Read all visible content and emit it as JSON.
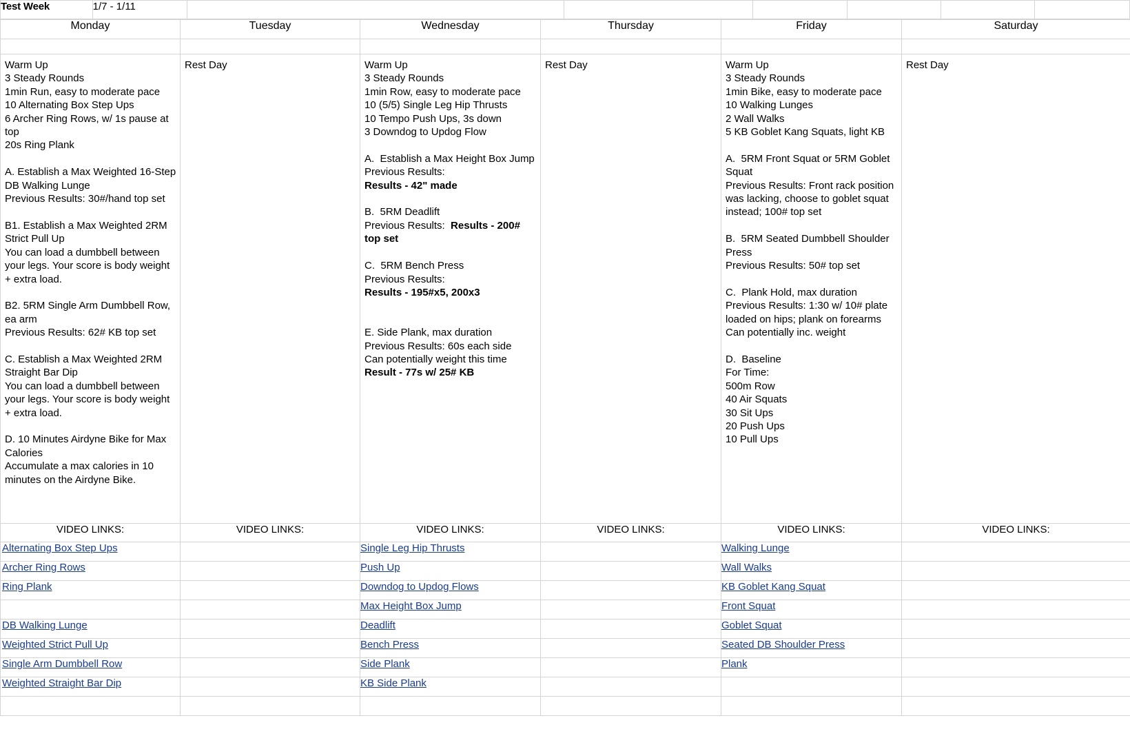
{
  "meta": {
    "title": "Test Week",
    "dates": "1/7 - 1/11"
  },
  "colors": {
    "header_band": "#fbe2cd",
    "sub_band": "#fae0ca",
    "link": "#1a3c8c",
    "grid_line": "#d4d4d4"
  },
  "days": [
    {
      "name": "Monday"
    },
    {
      "name": "Tuesday"
    },
    {
      "name": "Wednesday"
    },
    {
      "name": "Thursday"
    },
    {
      "name": "Friday"
    },
    {
      "name": "Saturday"
    }
  ],
  "workouts": {
    "monday": "Warm Up\n3 Steady Rounds\n1min Run, easy to moderate pace\n10 Alternating Box Step Ups\n6 Archer Ring Rows, w/ 1s pause at top\n20s Ring Plank\n\nA. Establish a Max Weighted 16-Step DB Walking Lunge\nPrevious Results: 30#/hand top set\n\nB1. Establish a Max Weighted 2RM Strict Pull Up\nYou can load a dumbbell between your legs. Your score is body weight + extra load.\n\nB2. 5RM Single Arm Dumbbell Row, ea arm\nPrevious Results: 62# KB top set\n\nC. Establish a Max Weighted 2RM Straight Bar Dip\nYou can load a dumbbell between your legs. Your score is body weight + extra load.\n\nD. 10 Minutes Airdyne Bike for Max Calories\nAccumulate a max calories in 10 minutes on the Airdyne Bike.",
    "tuesday": "Rest Day",
    "wednesday_part1": "Warm Up\n3 Steady Rounds\n1min Row, easy to moderate pace\n10 (5/5) Single Leg Hip Thrusts\n10 Tempo Push Ups, 3s down\n3 Downdog to Updog Flow\n\nA.  Establish a Max Height Box Jump\nPrevious Results:\n",
    "wednesday_bold1": "Results - 42\" made",
    "wednesday_part2": "\n\nB.  5RM Deadlift\nPrevious Results:  ",
    "wednesday_bold2": "Results - 200# top set",
    "wednesday_part3": "\n\nC.  5RM Bench Press\nPrevious Results:\n",
    "wednesday_bold3": "Results - 195#x5, 200x3",
    "wednesday_part4": "\n\n\nE. Side Plank, max duration\nPrevious Results: 60s each side\nCan potentially weight this time\n",
    "wednesday_bold4": "Result - 77s w/ 25# KB",
    "thursday": "Rest Day",
    "friday": "Warm Up\n3 Steady Rounds\n1min Bike, easy to moderate pace\n10 Walking Lunges\n2 Wall Walks\n5 KB Goblet Kang Squats, light KB\n\nA.  5RM Front Squat or 5RM Goblet Squat\nPrevious Results: Front rack position was lacking, choose to goblet squat instead; 100# top set\n\nB.  5RM Seated Dumbbell Shoulder Press\nPrevious Results: 50# top set\n\nC.  Plank Hold, max duration\nPrevious Results: 1:30 w/ 10# plate loaded on hips; plank on forearms\nCan potentially inc. weight\n\nD.  Baseline\nFor Time:\n500m Row\n40 Air Squats\n30 Sit Ups\n20 Push Ups\n10 Pull Ups",
    "saturday": "Rest Day"
  },
  "video_links": {
    "header": "VIDEO LINKS:",
    "monday": [
      "Alternating Box Step Ups",
      "Archer Ring Rows",
      "Ring Plank",
      "",
      "DB Walking Lunge",
      "Weighted Strict Pull Up",
      "Single Arm Dumbbell Row",
      "Weighted Straight Bar Dip",
      ""
    ],
    "tuesday": [
      "",
      "",
      "",
      "",
      "",
      "",
      "",
      "",
      ""
    ],
    "wednesday": [
      "Single Leg Hip Thrusts",
      "Push Up",
      "Downdog to Updog Flows",
      "Max Height Box Jump",
      "Deadlift",
      "Bench Press",
      "Side Plank",
      "KB Side Plank",
      ""
    ],
    "thursday": [
      "",
      "",
      "",
      "",
      "",
      "",
      "",
      "",
      ""
    ],
    "friday": [
      "Walking Lunge",
      "Wall Walks",
      "KB Goblet Kang Squat",
      "Front Squat",
      "Goblet Squat",
      "Seated DB Shoulder Press",
      "Plank",
      "",
      ""
    ],
    "saturday": [
      "",
      "",
      "",
      "",
      "",
      "",
      "",
      "",
      ""
    ]
  }
}
